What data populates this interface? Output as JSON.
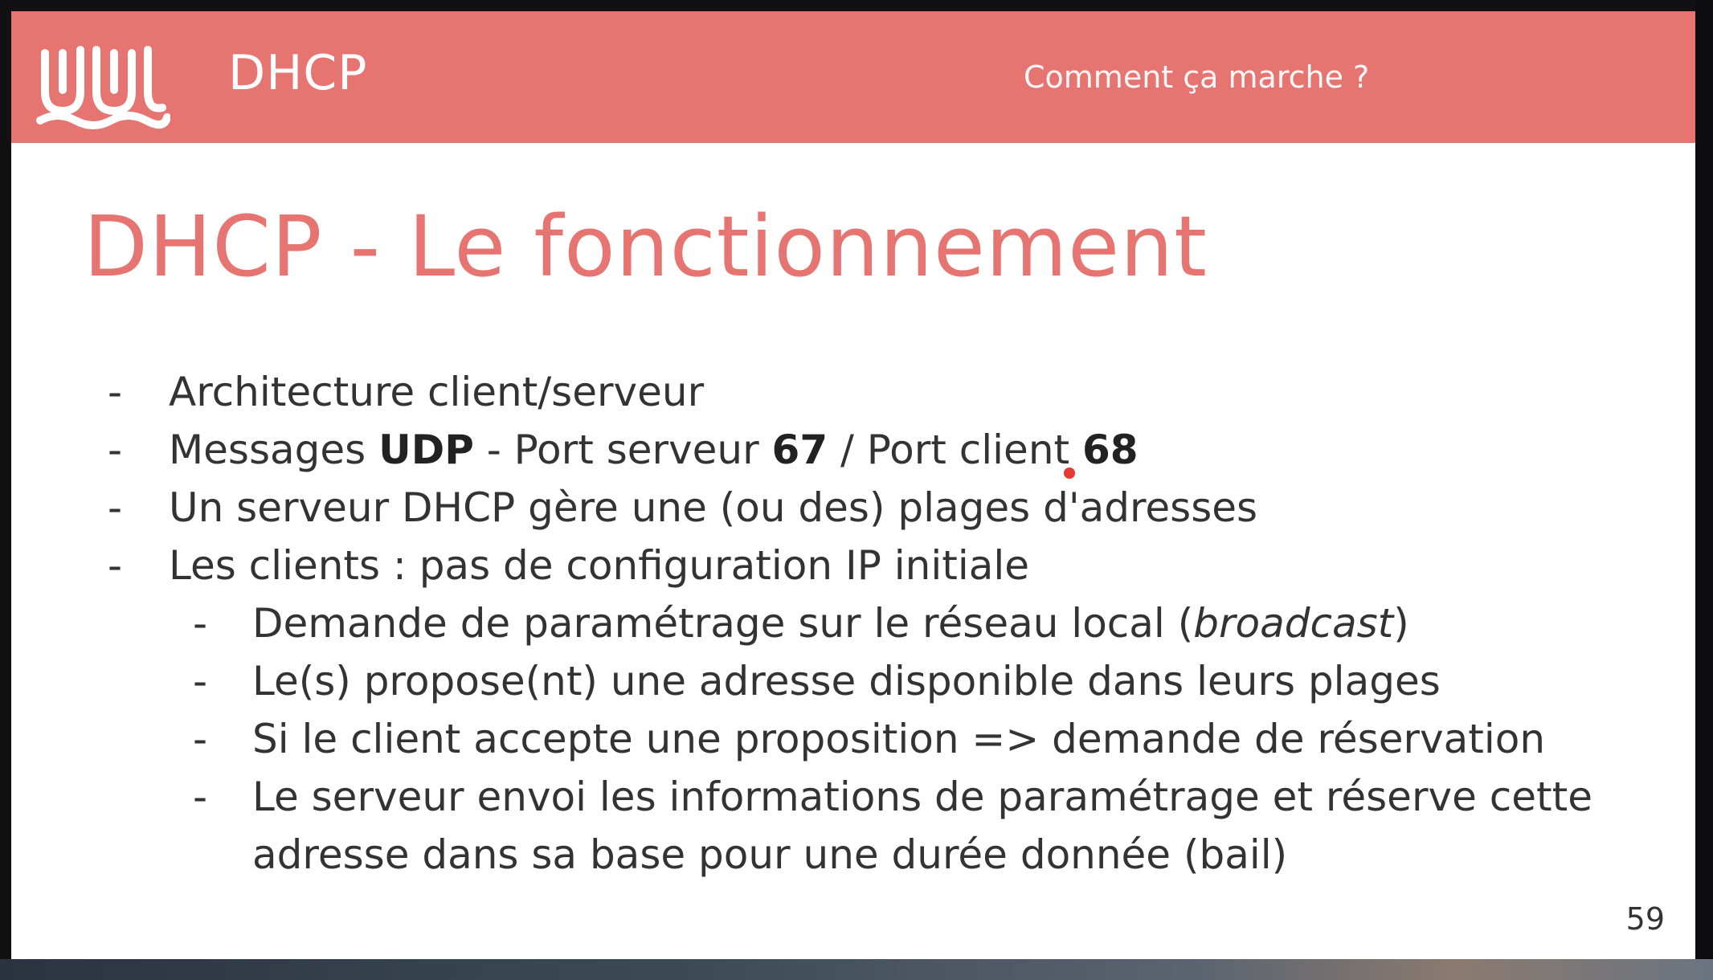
{
  "header": {
    "title": "DHCP",
    "subtitle": "Comment ça marche ?"
  },
  "slide": {
    "title": "DHCP - Le fonctionnement",
    "bullets": {
      "b1": "Architecture client/serveur",
      "b2": {
        "pre": "Messages ",
        "udp": "UDP",
        "mid": " - Port serveur ",
        "port_server": "67",
        "mid2": " / Port client ",
        "port_client": "68"
      },
      "b3": "Un serveur DHCP gère une (ou des) plages d'adresses",
      "b4": "Les clients : pas de configuration IP initiale",
      "s1": {
        "pre": "Demande de paramétrage sur le réseau local (",
        "em": "broadcast",
        "post": ")"
      },
      "s2": "Le(s) propose(nt) une adresse disponible dans leurs plages",
      "s3": "Si le client accepte une proposition => demande de réservation",
      "s4a": "Le serveur envoi les informations de paramétrage et réserve cette",
      "s4b": "adresse dans sa base pour une durée donnée (bail)",
      "dash": "-"
    },
    "page_number": "59"
  },
  "colors": {
    "accent": "#e67572",
    "text": "#333333",
    "pointer_dot": "#e53935"
  },
  "icons": {
    "logo": "wavy-u-logo-icon"
  }
}
